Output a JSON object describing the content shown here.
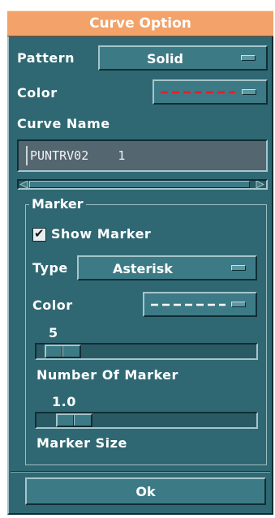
{
  "dialog": {
    "title": "Curve Option",
    "pattern": {
      "label": "Pattern",
      "value": "Solid"
    },
    "color": {
      "label": "Color",
      "swatch_color": "#e0202a"
    },
    "curve_name": {
      "label": "Curve Name",
      "value": "PUNTRV02    1"
    },
    "marker": {
      "group_title": "Marker",
      "show_marker": {
        "label": "Show Marker",
        "checked": true,
        "check_glyph": "✔"
      },
      "type": {
        "label": "Type",
        "value": "Asterisk"
      },
      "color": {
        "label": "Color",
        "swatch_color": "#ffffff"
      },
      "number_of_marker": {
        "label": "Number Of Marker",
        "value": "5"
      },
      "marker_size": {
        "label": "Marker Size",
        "value": "1.0"
      }
    },
    "ok_label": "Ok"
  },
  "colors": {
    "panel": "#2f6873",
    "title_bar": "#f3a269"
  }
}
